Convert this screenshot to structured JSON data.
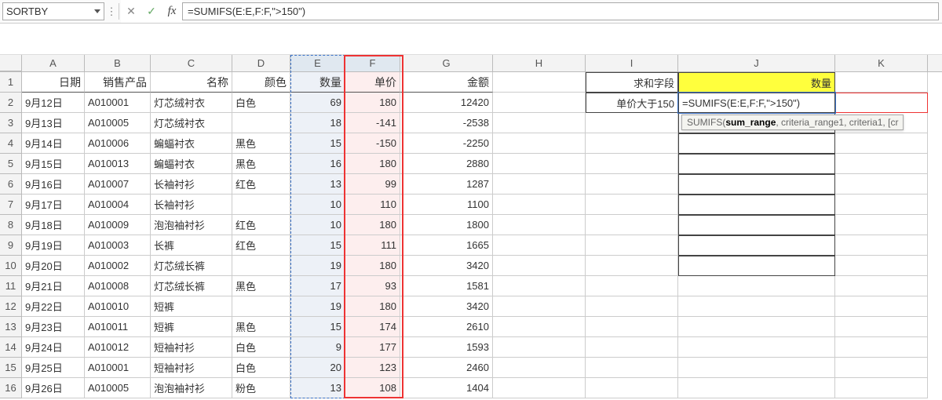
{
  "namebox": "SORTBY",
  "formula_bar": "=SUMIFS(E:E,F:F,\">150\")",
  "tooltip_prefix": "SUMIFS(",
  "tooltip_bold": "sum_range",
  "tooltip_rest": ", criteria_range1, criteria1, [cr",
  "col_labels": [
    "A",
    "B",
    "C",
    "D",
    "E",
    "F",
    "G",
    "H",
    "I",
    "J",
    "K"
  ],
  "headers": {
    "A": "日期",
    "B": "销售产品",
    "C": "名称",
    "D": "颜色",
    "E": "数量",
    "F": "单价",
    "G": "金额"
  },
  "side": {
    "label_field": "求和字段",
    "label_cond": "单价大于150",
    "j1": "数量",
    "j2": "=SUMIFS(E:E,F:F,\">150\")"
  },
  "chart_data": {
    "type": "table",
    "columns": [
      "日期",
      "销售产品",
      "名称",
      "颜色",
      "数量",
      "单价",
      "金额"
    ],
    "rows": [
      [
        "9月12日",
        "A010001",
        "灯芯绒衬衣",
        "白色",
        69,
        180,
        12420
      ],
      [
        "9月13日",
        "A010005",
        "灯芯绒衬衣",
        "",
        18,
        -141,
        -2538
      ],
      [
        "9月14日",
        "A010006",
        "蝙蝠衬衣",
        "黑色",
        15,
        -150,
        -2250
      ],
      [
        "9月15日",
        "A010013",
        "蝙蝠衬衣",
        "黑色",
        16,
        180,
        2880
      ],
      [
        "9月16日",
        "A010007",
        "长袖衬衫",
        "红色",
        13,
        99,
        1287
      ],
      [
        "9月17日",
        "A010004",
        "长袖衬衫",
        "",
        10,
        110,
        1100
      ],
      [
        "9月18日",
        "A010009",
        "泡泡袖衬衫",
        "红色",
        10,
        180,
        1800
      ],
      [
        "9月19日",
        "A010003",
        "长裤",
        "红色",
        15,
        111,
        1665
      ],
      [
        "9月20日",
        "A010002",
        "灯芯绒长裤",
        "",
        19,
        180,
        3420
      ],
      [
        "9月21日",
        "A010008",
        "灯芯绒长裤",
        "黑色",
        17,
        93,
        1581
      ],
      [
        "9月22日",
        "A010010",
        "短裤",
        "",
        19,
        180,
        3420
      ],
      [
        "9月23日",
        "A010011",
        "短裤",
        "黑色",
        15,
        174,
        2610
      ],
      [
        "9月24日",
        "A010012",
        "短袖衬衫",
        "白色",
        9,
        177,
        1593
      ],
      [
        "9月25日",
        "A010001",
        "短袖衬衫",
        "白色",
        20,
        123,
        2460
      ],
      [
        "9月26日",
        "A010005",
        "泡泡袖衬衫",
        "粉色",
        13,
        108,
        1404
      ]
    ]
  }
}
